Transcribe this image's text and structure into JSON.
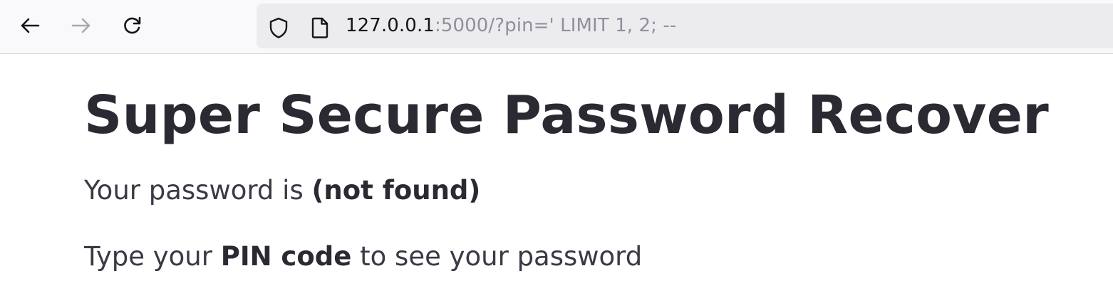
{
  "browser": {
    "back_icon": "arrow-left-icon",
    "forward_icon": "arrow-right-icon",
    "reload_icon": "reload-icon",
    "shield_icon": "shield-icon",
    "page_icon": "document-icon",
    "url_host": "127.0.0.1",
    "url_rest": ":5000/?pin=' LIMIT 1, 2; --"
  },
  "page": {
    "title": "Super Secure Password Recover",
    "password_prefix": "Your password is ",
    "password_value": "(not found)",
    "pin_prefix": "Type your ",
    "pin_bold": "PIN code",
    "pin_suffix": " to see your password"
  },
  "colors": {
    "toolbar_bg": "#f9f9fb",
    "urlbar_bg": "#ececee",
    "text": "#2b2a33",
    "url_dim": "#8f8f9d"
  }
}
